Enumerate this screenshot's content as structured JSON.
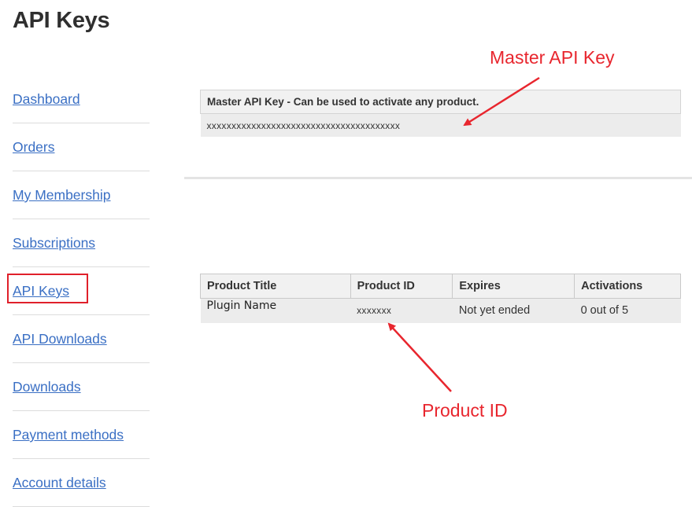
{
  "page": {
    "title": "API Keys"
  },
  "sidebar": {
    "items": [
      {
        "label": "Dashboard"
      },
      {
        "label": "Orders"
      },
      {
        "label": "My Membership"
      },
      {
        "label": "Subscriptions"
      },
      {
        "label": "API Keys",
        "active": true
      },
      {
        "label": "API Downloads"
      },
      {
        "label": "Downloads"
      },
      {
        "label": "Payment methods"
      },
      {
        "label": "Account details"
      }
    ]
  },
  "master_key": {
    "header": "Master API Key - Can be used to activate any product.",
    "value": "xxxxxxxxxxxxxxxxxxxxxxxxxxxxxxxxxxxxxxx"
  },
  "products": {
    "columns": [
      "Product Title",
      "Product ID",
      "Expires",
      "Activations"
    ],
    "rows": [
      {
        "title": "Plugin Name",
        "id": "xxxxxxx",
        "expires": "Not yet ended",
        "activations": "0 out of 5"
      }
    ]
  },
  "annotations": {
    "master_label": "Master API Key",
    "product_label": "Product ID",
    "color": "#e8262e"
  },
  "colors": {
    "link": "#3a6fc4",
    "highlight": "#e0202a"
  }
}
